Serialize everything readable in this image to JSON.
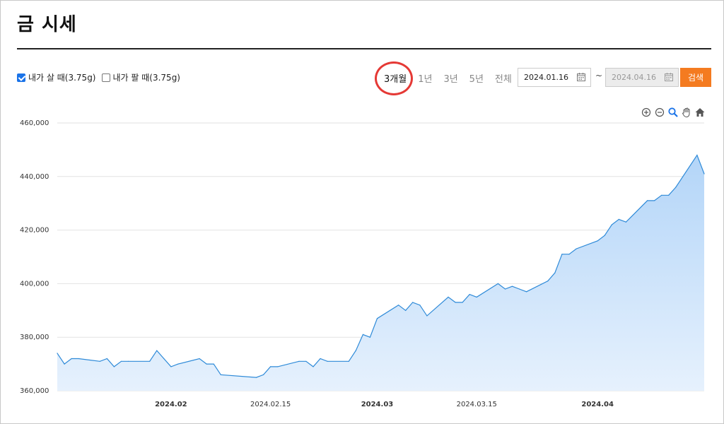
{
  "page": {
    "title": "금 시세"
  },
  "controls": {
    "checkboxes": [
      {
        "label": "내가 살 때(3.75g)",
        "checked": true
      },
      {
        "label": "내가 팔 때(3.75g)",
        "checked": false
      }
    ],
    "periods": [
      "3개월",
      "1년",
      "3년",
      "5년",
      "전체"
    ],
    "active_period": "3개월",
    "date_from": "2024.01.16",
    "date_tilde": "~",
    "date_to": "2024.04.16",
    "search_label": "검색"
  },
  "toolbar": {
    "icons": [
      "zoom-in-icon",
      "zoom-out-icon",
      "magnify-icon",
      "pan-hand-icon",
      "home-icon"
    ]
  },
  "colors": {
    "accent": "#f47b20",
    "line": "#2e8ad8",
    "fill_top": "#b3d5f8",
    "fill_bottom": "#e6f1fd",
    "highlight": "#e53935"
  },
  "chart_data": {
    "type": "area",
    "title": "",
    "xlabel": "",
    "ylabel": "",
    "ylim": [
      360000,
      460000
    ],
    "yticks": [
      "360,000",
      "380,000",
      "400,000",
      "420,000",
      "440,000",
      "460,000"
    ],
    "xticks": [
      {
        "label": "2024.02",
        "date": "2024-02-01",
        "bold": true
      },
      {
        "label": "2024.02.15",
        "date": "2024-02-15",
        "bold": false
      },
      {
        "label": "2024.03",
        "date": "2024-03-01",
        "bold": true
      },
      {
        "label": "2024.03.15",
        "date": "2024-03-15",
        "bold": false
      },
      {
        "label": "2024.04",
        "date": "2024-04-01",
        "bold": true
      }
    ],
    "grid": true,
    "series": [
      {
        "x": [
          "2024-01-16",
          "2024-01-17",
          "2024-01-18",
          "2024-01-19",
          "2024-01-22",
          "2024-01-23",
          "2024-01-24",
          "2024-01-25",
          "2024-01-26",
          "2024-01-29",
          "2024-01-30",
          "2024-01-31",
          "2024-02-01",
          "2024-02-02",
          "2024-02-05",
          "2024-02-06",
          "2024-02-07",
          "2024-02-08",
          "2024-02-13",
          "2024-02-14",
          "2024-02-15",
          "2024-02-16",
          "2024-02-19",
          "2024-02-20",
          "2024-02-21",
          "2024-02-22",
          "2024-02-23",
          "2024-02-26",
          "2024-02-27",
          "2024-02-28",
          "2024-02-29",
          "2024-03-01",
          "2024-03-04",
          "2024-03-05",
          "2024-03-06",
          "2024-03-07",
          "2024-03-08",
          "2024-03-11",
          "2024-03-12",
          "2024-03-13",
          "2024-03-14",
          "2024-03-15",
          "2024-03-18",
          "2024-03-19",
          "2024-03-20",
          "2024-03-21",
          "2024-03-22",
          "2024-03-25",
          "2024-03-26",
          "2024-03-27",
          "2024-03-28",
          "2024-03-29",
          "2024-04-01",
          "2024-04-02",
          "2024-04-03",
          "2024-04-04",
          "2024-04-05",
          "2024-04-08",
          "2024-04-09",
          "2024-04-10",
          "2024-04-11",
          "2024-04-12",
          "2024-04-15",
          "2024-04-16"
        ],
        "values": [
          374000,
          370000,
          372000,
          372000,
          371000,
          372000,
          369000,
          371000,
          371000,
          371000,
          375000,
          372000,
          369000,
          370000,
          372000,
          370000,
          370000,
          366000,
          365000,
          366000,
          369000,
          369000,
          371000,
          371000,
          369000,
          372000,
          371000,
          371000,
          375000,
          381000,
          380000,
          387000,
          392000,
          390000,
          393000,
          392000,
          388000,
          395000,
          393000,
          393000,
          396000,
          395000,
          400000,
          398000,
          399000,
          398000,
          397000,
          401000,
          404000,
          411000,
          411000,
          413000,
          416000,
          418000,
          422000,
          424000,
          423000,
          431000,
          431000,
          433000,
          433000,
          436000,
          448000,
          441000
        ]
      }
    ]
  }
}
